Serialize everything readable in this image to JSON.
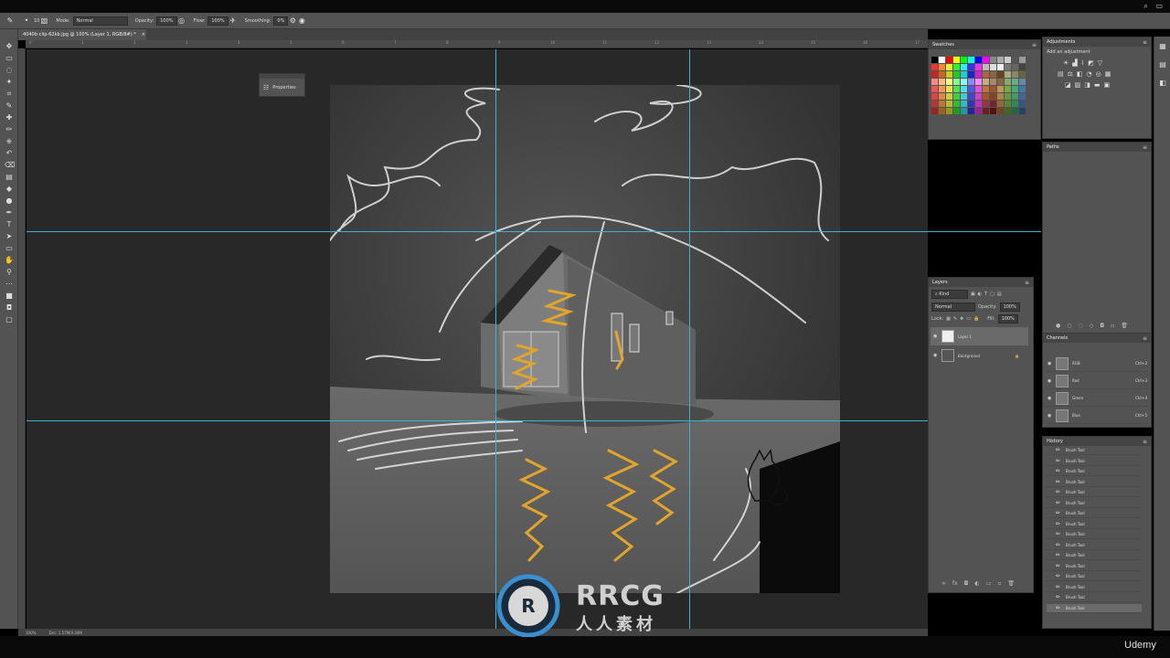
{
  "options_bar": {
    "mode_label": "Mode:",
    "mode_value": "Normal",
    "opacity_label": "Opacity:",
    "opacity_value": "100%",
    "flow_label": "Flow:",
    "flow_value": "100%",
    "smoothing_label": "Smoothing:",
    "smoothing_value": "0%",
    "brush_size": "10"
  },
  "document": {
    "tab_title": "4040b-clip-62kb.jpg @ 100% (Layer 1, RGB/8#) *",
    "zoom": "100%",
    "doc_info": "Doc: 1.57M/4.30M"
  },
  "ruler_ticks": [
    "0",
    "1",
    "2",
    "3",
    "4",
    "5",
    "6",
    "7",
    "8",
    "9",
    "10",
    "11",
    "12",
    "13",
    "14",
    "15",
    "16",
    "17"
  ],
  "properties_panel": {
    "label": "Properties"
  },
  "swatches_panel": {
    "title": "Swatches"
  },
  "adjustments_panel": {
    "title": "Adjustments",
    "subtitle": "Add an adjustment"
  },
  "paths_panel": {
    "title": "Paths"
  },
  "layers_panel": {
    "title": "Layers",
    "filter_kind": "Kind",
    "blend_mode": "Normal",
    "opacity_label": "Opacity:",
    "opacity_value": "100%",
    "lock_label": "Lock:",
    "fill_label": "Fill:",
    "fill_value": "100%",
    "layers": [
      {
        "name": "Layer 1",
        "selected": true
      },
      {
        "name": "Background",
        "selected": false
      }
    ]
  },
  "channels_panel": {
    "title": "Channels",
    "channels": [
      {
        "name": "RGB",
        "shortcut": "Ctrl+2"
      },
      {
        "name": "Red",
        "shortcut": "Ctrl+3"
      },
      {
        "name": "Green",
        "shortcut": "Ctrl+4"
      },
      {
        "name": "Blue",
        "shortcut": "Ctrl+5"
      }
    ]
  },
  "history_panel": {
    "title": "History",
    "items": [
      "Brush Tool",
      "Brush Tool",
      "Brush Tool",
      "Brush Tool",
      "Brush Tool",
      "Brush Tool",
      "Brush Tool",
      "Brush Tool",
      "Brush Tool",
      "Brush Tool",
      "Brush Tool",
      "Brush Tool",
      "Brush Tool",
      "Brush Tool",
      "Brush Tool",
      "Brush Tool"
    ]
  },
  "watermark": {
    "title": "RRCG",
    "subtitle": "人人素材"
  },
  "brand": "Udemy",
  "colors": {
    "ui_panel": "#535353",
    "workspace": "#282828",
    "guide": "#3fb3c9",
    "sketch_orange": "#e0a52a"
  }
}
